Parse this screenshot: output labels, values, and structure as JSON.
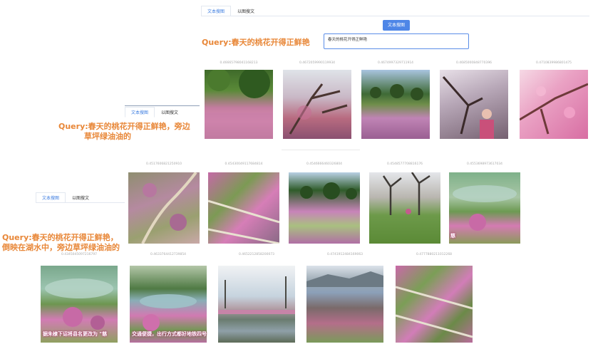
{
  "tabs_top": [
    "文本搜图",
    "以图搜文"
  ],
  "tabs_mid": [
    "文本搜图",
    "以图搜文"
  ],
  "tabs_bottom": [
    "文本搜图",
    "以图搜文"
  ],
  "search_button": "文本搜图",
  "query_input_value": "春天的桃花开得正鲜艳",
  "queries": {
    "q1": "Query:春天的桃花开得正鲜艳",
    "q2_line1": "Query:春天的桃花开得正鲜艳，旁边",
    "q2_line2": "草坪绿油油的",
    "q3_line1": "Query:春天的桃花开得正鲜艳，",
    "q3_line2": "倒映在湖水中，旁边草坪绿油油的"
  },
  "row1_scores": [
    "0.46665798041168213",
    "0.4672059990119934",
    "0.4674997329711914",
    "0.4685000848770396",
    "0.4710839986801475"
  ],
  "row2_scores": [
    "0.4517606821250910",
    "0.45430049117684814",
    "0.4546666460326804",
    "0.4548577708816176",
    "0.4553698973617034"
  ],
  "row3_scores": [
    "0.4345045097216797",
    "0.4633764412739854",
    "0.4652212858200073",
    "0.4741912484169063",
    "0.4777880211012268"
  ],
  "overlay_caption_left": "据朱棣下诏将县名更改为 \"慈",
  "overlay_caption_mid": "交通便捷，出行方式都好地铁四号",
  "overlay_caption_right": "慈",
  "palette": {
    "accent": "#4e86e7",
    "query_orange": "#e88738",
    "blossom_pink": "#d97fb5",
    "grass_green": "#6f9a3f"
  }
}
